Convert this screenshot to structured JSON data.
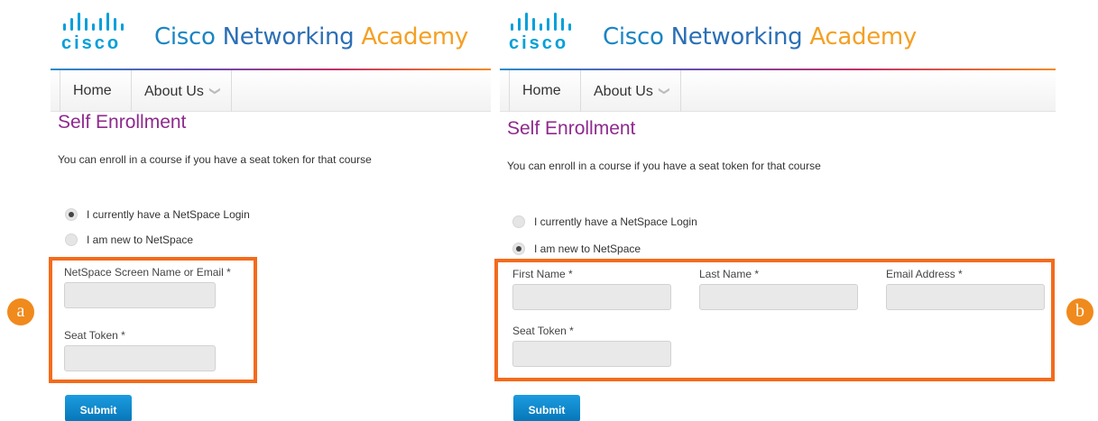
{
  "brand": {
    "logo_text": "cisco",
    "title_part1": "Cisco",
    "title_part2": "Networking",
    "title_part3": "Academy"
  },
  "nav": {
    "home": "Home",
    "about": "About Us"
  },
  "page": {
    "heading": "Self Enrollment",
    "intro": "You can enroll in a course if you have a seat token for that course"
  },
  "panel_a": {
    "badge": "a",
    "radio_login": "I currently have a NetSpace Login",
    "radio_new": "I am new to NetSpace",
    "selected": "login",
    "field_screen_name": "NetSpace Screen Name or Email *",
    "field_seat_token": "Seat Token *",
    "submit": "Submit"
  },
  "panel_b": {
    "badge": "b",
    "radio_login": "I currently have a NetSpace Login",
    "radio_new": "I am new to NetSpace",
    "selected": "new",
    "field_first_name": "First Name *",
    "field_last_name": "Last Name *",
    "field_email": "Email Address *",
    "field_seat_token": "Seat Token *",
    "submit": "Submit"
  },
  "colors": {
    "accent_orange": "#f36b1c",
    "heading_purple": "#8e2a8e",
    "cisco_blue": "#049fd9",
    "submit_blue": "#0a86cc"
  }
}
